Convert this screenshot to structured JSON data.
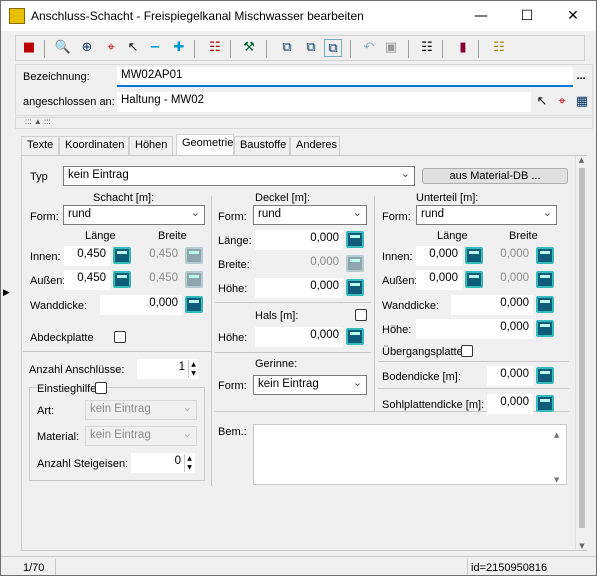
{
  "window": {
    "title": "Anschluss-Schacht - Freispiegelkanal Mischwasser bearbeiten",
    "minimize": "—",
    "maximize": "☐",
    "close": "✕"
  },
  "toolbar": {
    "icons": [
      "door-exit-icon",
      "zoom-icon",
      "zoom-area-icon",
      "crosshair-icon",
      "pointer-icon",
      "minus-icon",
      "plus-icon",
      "network-icon",
      "tool-icon",
      "layers-icon",
      "layers-select-icon",
      "layers-copy-icon",
      "undo-icon",
      "save-icon",
      "document-icon",
      "book-icon",
      "grid-icon"
    ]
  },
  "header": {
    "bezeichnung_label": "Bezeichnung:",
    "bezeichnung_value": "MW02AP01",
    "more_button": "...",
    "angeschlossen_label": "angeschlossen an:",
    "angeschlossen_value": "Haltung - MW02",
    "collapse_label": "::: ▲ :::"
  },
  "tabs": [
    "Texte",
    "Koordinaten",
    "Höhen",
    "Geometrie",
    "Baustoffe",
    "Anderes"
  ],
  "active_tab": "Geometrie",
  "geometrie": {
    "typ_label": "Typ",
    "typ_value": "kein Eintrag",
    "material_db_button": "aus Material-DB ...",
    "schacht": {
      "title": "Schacht [m]:",
      "form_label": "Form:",
      "form_value": "rund",
      "laenge_header": "Länge",
      "breite_header": "Breite",
      "innen_label": "Innen:",
      "innen_laenge": "0,450",
      "innen_breite": "0,450",
      "aussen_label": "Außen:",
      "aussen_laenge": "0,450",
      "aussen_breite": "0,450",
      "wanddicke_label": "Wanddicke:",
      "wanddicke_value": "0,000",
      "abdeckplatte_label": "Abdeckplatte"
    },
    "deckel": {
      "title": "Deckel [m]:",
      "form_label": "Form:",
      "form_value": "rund",
      "laenge_label": "Länge:",
      "laenge_value": "0,000",
      "breite_label": "Breite:",
      "breite_value": "0,000",
      "hoehe_label": "Höhe:",
      "hoehe_value": "0,000",
      "hals_title": "Hals [m]:",
      "hals_hoehe_label": "Höhe:",
      "hals_hoehe_value": "0,000"
    },
    "unterteil": {
      "title": "Unterteil [m]:",
      "form_label": "Form:",
      "form_value": "rund",
      "laenge_header": "Länge",
      "breite_header": "Breite",
      "innen_label": "Innen:",
      "innen_laenge": "0,000",
      "innen_breite": "0,000",
      "aussen_label": "Außen:",
      "aussen_laenge": "0,000",
      "aussen_breite": "0,000",
      "wanddicke_label": "Wanddicke:",
      "wanddicke_value": "0,000",
      "hoehe_label": "Höhe:",
      "hoehe_value": "0,000",
      "uebergangsplatte_label": "Übergangsplatte",
      "bodendicke_label": "Bodendicke [m]:",
      "bodendicke_value": "0,000",
      "sohlplattendicke_label": "Sohlplattendicke [m]:",
      "sohlplattendicke_value": "0,000"
    },
    "anschluesse": {
      "label": "Anzahl Anschlüsse:",
      "value": "1",
      "einstieghilfe_label": "Einstieghilfe",
      "art_label": "Art:",
      "art_value": "kein Eintrag",
      "material_label": "Material:",
      "material_value": "kein Eintrag",
      "steigeisen_label": "Anzahl Steigeisen:",
      "steigeisen_value": "0"
    },
    "gerinne": {
      "title": "Gerinne:",
      "form_label": "Form:",
      "form_value": "kein Eintrag"
    },
    "bem_label": "Bem.:"
  },
  "status": {
    "record": "1/70",
    "id": "id=2150950816"
  },
  "colors": {
    "accent": "#0078d7",
    "calc_icon": "#0f5c7a"
  }
}
